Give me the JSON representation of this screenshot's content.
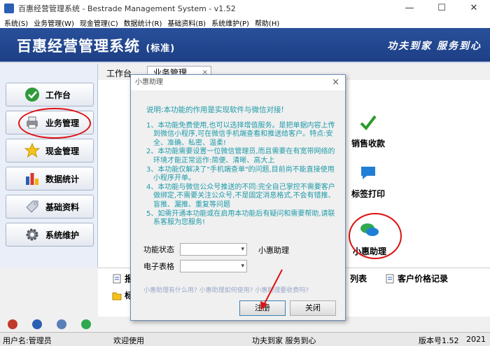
{
  "window": {
    "title": "百惠经营管理系统 - Bestrade Management System - v1.52",
    "controls": [
      "—",
      "☐",
      "✕"
    ]
  },
  "menu": [
    "系统(S)",
    "业务管理(W)",
    "现金管理(C)",
    "数据统计(R)",
    "基础资料(B)",
    "系统维护(P)",
    "帮助(H)"
  ],
  "banner": {
    "title": "百惠经营管理系统",
    "edition": "(标准)",
    "slogan": "功夫到家 服务到心"
  },
  "sidebar": {
    "items": [
      {
        "label": "工作台",
        "icon": "check-icon"
      },
      {
        "label": "业务管理",
        "icon": "printer-icon"
      },
      {
        "label": "现金管理",
        "icon": "star-icon"
      },
      {
        "label": "数据统计",
        "icon": "bar-chart-icon"
      },
      {
        "label": "基础资料",
        "icon": "tag-icon"
      },
      {
        "label": "系统维护",
        "icon": "gear-icon"
      }
    ]
  },
  "tabs": {
    "workbench": "工作台",
    "active": "业务管理",
    "close": "×"
  },
  "functions": {
    "sales_receipt": "销售收款",
    "label_print": "标签打印",
    "xiaohui": "小惠助理"
  },
  "lower": {
    "item1": "报",
    "item2": "标",
    "list": "列表",
    "customer_price": "客户价格记录"
  },
  "dialog": {
    "title": "小惠助理",
    "close": "×",
    "lead": "说明:本功能的作用是实现软件与微信对接!",
    "items": [
      "1、本功能免费使用,也可以选择增值服务。是把单据内容上传到微信小程序,可在微信手机端查看和推送给客户。特点:安全、准确、私密、温柔!",
      "2、本功能需要设置一位微信管理员,而且需要在有宽带网络的环境才能正常运作:简便、清晰、高大上",
      "3、本功能仅解决了\"手机端查单\"的问题,目前尚不能直接使用小程序开单。",
      "4、本功能与微信公众号推送的不同:完全自己掌控不需要客户做绑定,不需要关注公众号,不是固定消息格式,不会有错推、盲推、漏推、重复等问题",
      "5、如需开通本功能或在启用本功能后有疑问和需要帮助,请联系客服为您服务!"
    ],
    "status_label": "功能状态",
    "status_value": "",
    "sheet_label": "电子表格",
    "sheet_value": "",
    "side_label": "小惠助理",
    "help_links": "小惠助理有什么用? 小惠助理如何使用? 小惠助理要收费吗?",
    "register": "注册",
    "close_btn": "关闭"
  },
  "status": {
    "user": "用户名:管理员",
    "welcome": "欢迎使用",
    "motto": "功夫到家 服务到心",
    "version": "版本号1.52",
    "date": "2021"
  },
  "colors": {
    "banner": "#1d3f86",
    "notice_text": "#1e9aa8",
    "highlight": "#dd1111"
  }
}
